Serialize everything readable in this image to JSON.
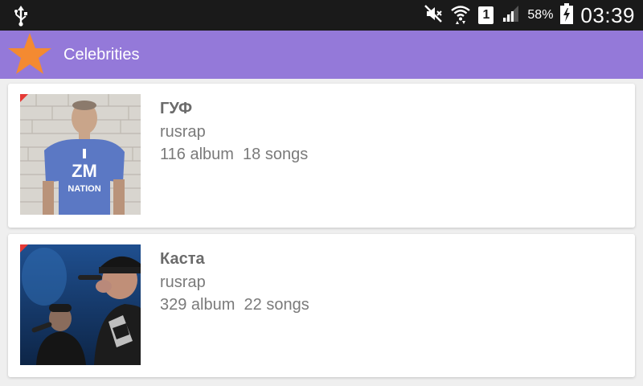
{
  "status_bar": {
    "usb_icon": "usb-icon",
    "mute_icon": "vibrate-mute-icon",
    "wifi_icon": "wifi-icon",
    "sim_label": "1",
    "signal_icon": "signal-icon",
    "battery_percent": "58%",
    "battery_icon": "battery-charging-icon",
    "time": "03:39"
  },
  "action_bar": {
    "logo_icon": "star-icon",
    "title": "Celebrities",
    "color": "#9479d9"
  },
  "celebrities": [
    {
      "name": "ГУФ",
      "genre": "rusrap",
      "albums": "116 album",
      "songs": "18 songs"
    },
    {
      "name": "Каста",
      "genre": "rusrap",
      "albums": "329 album",
      "songs": "22 songs"
    }
  ]
}
